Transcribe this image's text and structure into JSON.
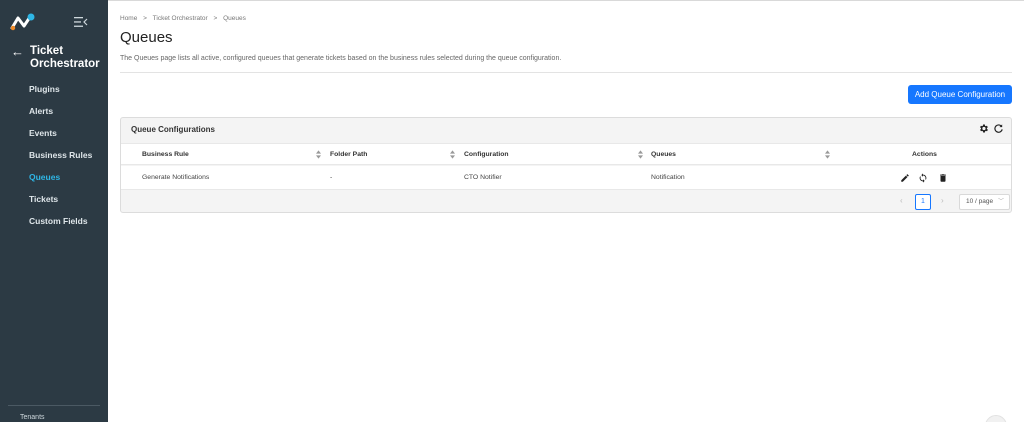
{
  "sidebar": {
    "app_title": "Ticket Orchestrator",
    "items": [
      {
        "label": "Plugins"
      },
      {
        "label": "Alerts"
      },
      {
        "label": "Events"
      },
      {
        "label": "Business Rules"
      },
      {
        "label": "Queues",
        "active": true
      },
      {
        "label": "Tickets"
      },
      {
        "label": "Custom Fields"
      }
    ],
    "footer_label": "Tenants"
  },
  "breadcrumb": [
    "Home",
    "Ticket Orchestrator",
    "Queues"
  ],
  "breadcrumb_sep": ">",
  "page": {
    "title": "Queues",
    "description": "The Queues page lists all active, configured queues that generate tickets based on the business rules selected during the queue configuration."
  },
  "toolbar": {
    "add_label": "Add Queue Configuration"
  },
  "panel": {
    "title": "Queue Configurations",
    "columns": [
      "Business Rule",
      "Folder Path",
      "Configuration",
      "Queues",
      "Actions"
    ],
    "rows": [
      [
        "Generate Notifications",
        "-",
        "CTO Notifier",
        "Notification"
      ]
    ]
  },
  "pagination": {
    "current_page": "1",
    "page_size": "10 / page"
  },
  "colors": {
    "sidebar_bg": "#2c3a44",
    "accent": "#1677ff",
    "active_nav": "#2eb6e6"
  },
  "icons": [
    "menu-fold-icon",
    "arrow-left-icon",
    "gear-icon",
    "refresh-icon",
    "sort-icon",
    "edit-icon",
    "sync-icon",
    "delete-icon",
    "chevron-down-icon"
  ]
}
